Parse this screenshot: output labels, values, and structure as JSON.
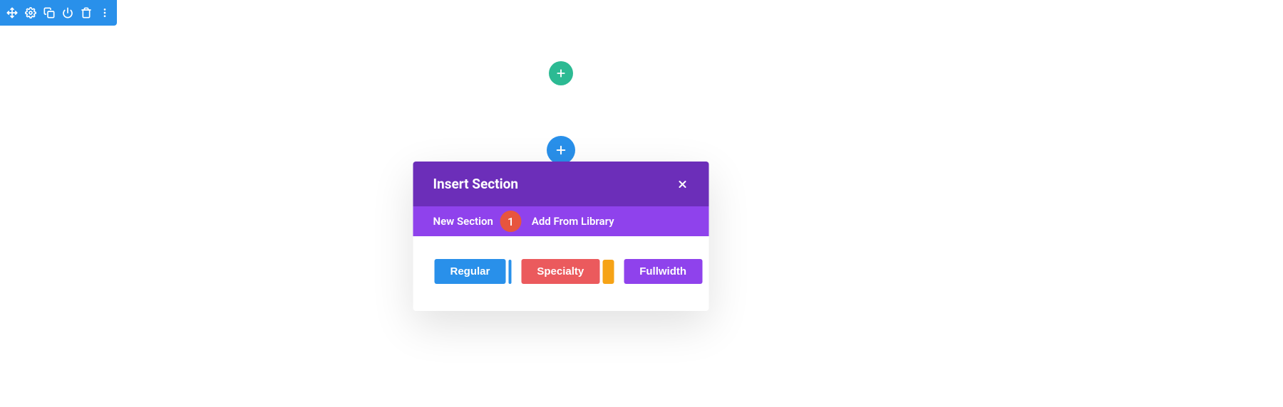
{
  "toolbar": {
    "icons": [
      "move",
      "settings",
      "duplicate",
      "power",
      "delete",
      "more"
    ]
  },
  "add_button_green": {
    "name": "add-module"
  },
  "add_button_blue": {
    "name": "add-section"
  },
  "modal": {
    "title": "Insert Section",
    "tabs": {
      "new_section": "New Section",
      "add_from_library": "Add From Library"
    },
    "annotation": "1",
    "buttons": {
      "regular": "Regular",
      "specialty": "Specialty",
      "fullwidth": "Fullwidth"
    }
  }
}
